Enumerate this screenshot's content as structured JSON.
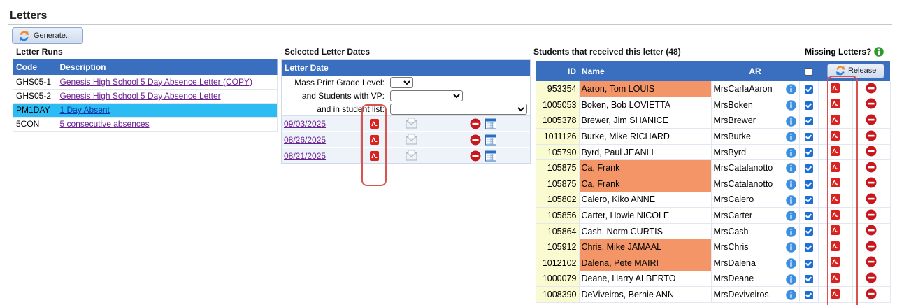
{
  "header": {
    "title": "Letters",
    "generate_label": "Generate..."
  },
  "runs": {
    "title": "Letter Runs",
    "columns": [
      "Code",
      "Description"
    ],
    "rows": [
      {
        "code": "GHS05-1",
        "desc": "Genesis High School 5 Day Absence Letter (COPY)",
        "selected": false
      },
      {
        "code": "GHS05-2",
        "desc": "Genesis High School 5 Day Absence Letter",
        "selected": false
      },
      {
        "code": "PM1DAY",
        "desc": "1 Day Absent",
        "selected": true
      },
      {
        "code": "5CON",
        "desc": "5 consecutive absences",
        "selected": false
      }
    ]
  },
  "dates": {
    "title": "Selected Letter Dates",
    "header": "Letter Date",
    "filters": {
      "grade_label": "Mass Print Grade Level:",
      "vp_label": "and Students with VP:",
      "list_label": "and in student list:"
    },
    "rows": [
      "09/03/2025",
      "08/26/2025",
      "08/21/2025"
    ]
  },
  "students": {
    "title": "Students that received this letter (48)",
    "missing_label": "Missing Letters?",
    "columns": {
      "id": "ID",
      "name": "Name",
      "ar": "AR"
    },
    "release_label": "Release",
    "rows": [
      {
        "id": "953354",
        "name": "Aaron, Tom LOUIS",
        "ar": "MrsCarlaAaron",
        "flag": true
      },
      {
        "id": "1005053",
        "name": "Boken, Bob LOVIETTA",
        "ar": "MrsBoken",
        "flag": false
      },
      {
        "id": "1005378",
        "name": "Brewer, Jim SHANICE",
        "ar": "MrsBrewer",
        "flag": false
      },
      {
        "id": "1011126",
        "name": "Burke, Mike RICHARD",
        "ar": "MrsBurke",
        "flag": false
      },
      {
        "id": "105790",
        "name": "Byrd, Paul JEANLL",
        "ar": "MrsByrd",
        "flag": false
      },
      {
        "id": "105875",
        "name": "Ca, Frank",
        "ar": "MrsCatalanotto",
        "flag": true
      },
      {
        "id": "105875",
        "name": "Ca, Frank",
        "ar": "MrsCatalanotto",
        "flag": true
      },
      {
        "id": "105802",
        "name": "Calero, Kiko ANNE",
        "ar": "MrsCalero",
        "flag": false
      },
      {
        "id": "105856",
        "name": "Carter, Howie NICOLE",
        "ar": "MrsCarter",
        "flag": false
      },
      {
        "id": "105864",
        "name": "Cash, Norm CURTIS",
        "ar": "MrsCash",
        "flag": false
      },
      {
        "id": "105912",
        "name": "Chris, Mike JAMAAL",
        "ar": "MrsChris",
        "flag": true
      },
      {
        "id": "1012102",
        "name": "Dalena, Pete MAIRI",
        "ar": "MrsDalena",
        "flag": true
      },
      {
        "id": "1000079",
        "name": "Deane, Harry ALBERTO",
        "ar": "MrsDeane",
        "flag": false
      },
      {
        "id": "1008390",
        "name": "DeViveiros, Bernie ANN",
        "ar": "MrsDeviveiros",
        "flag": false
      }
    ]
  },
  "colors": {
    "header_blue": "#3a6fbf",
    "selected_row": "#2bbcf4",
    "flag_orange": "#f39566",
    "id_yellow": "#fbfbd2",
    "highlight_red": "#d9534f"
  },
  "icons": [
    "refresh-icon",
    "pdf-icon",
    "email-icon",
    "delete-icon",
    "calendar-icon",
    "info-icon",
    "checkbox-icon"
  ]
}
